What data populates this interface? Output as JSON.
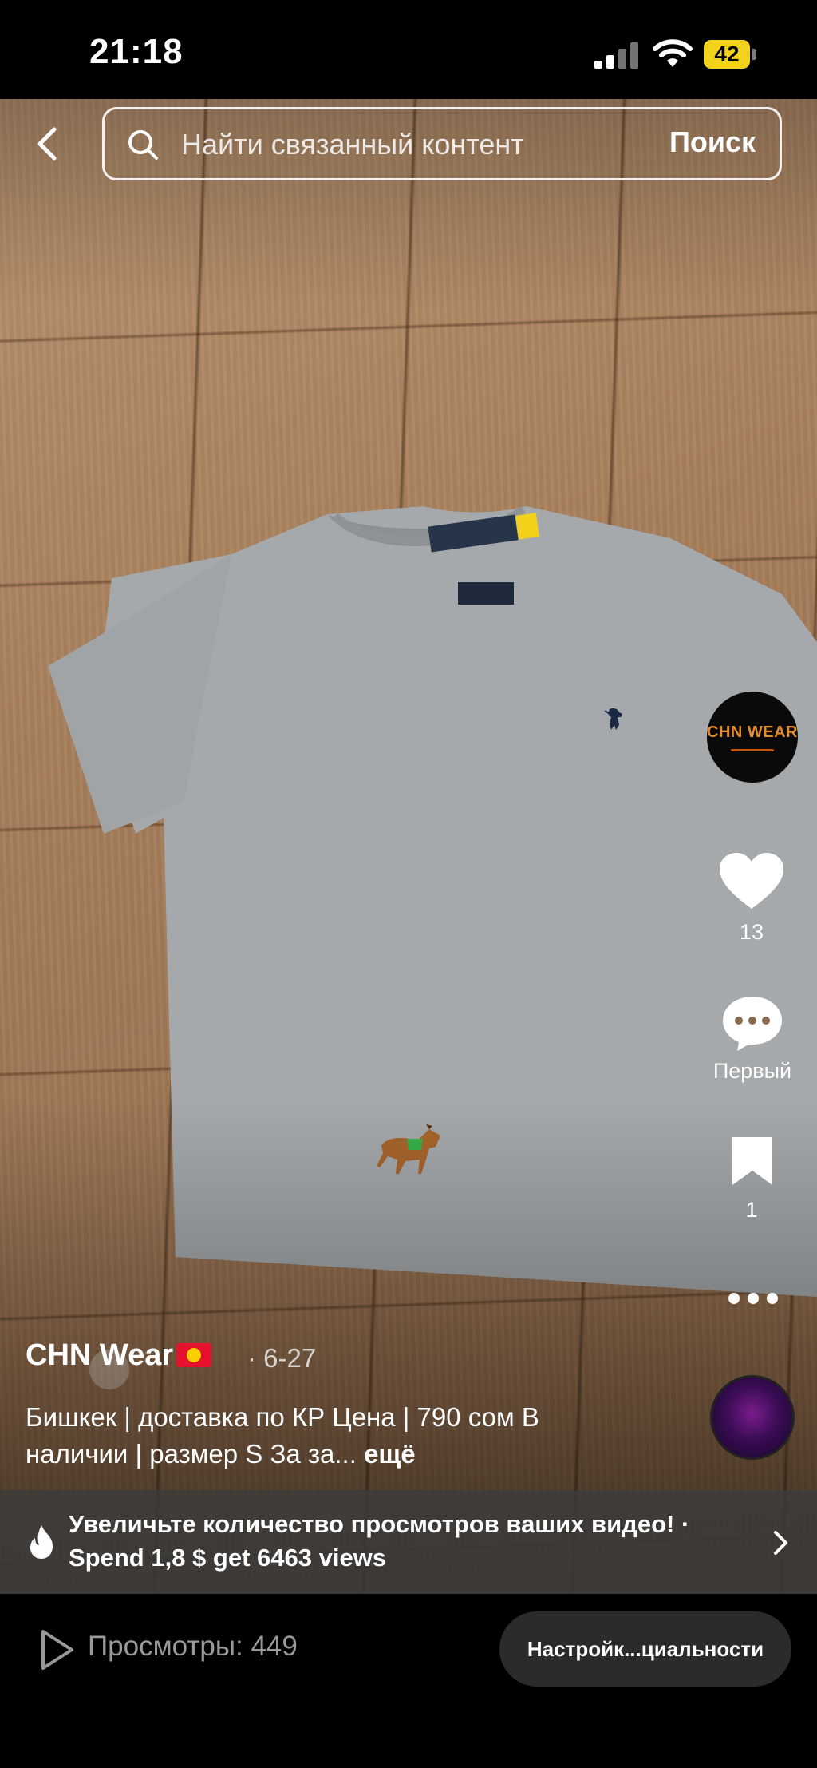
{
  "status": {
    "time": "21:18",
    "battery": "42"
  },
  "search": {
    "placeholder": "Найти связанный контент",
    "button": "Поиск"
  },
  "creator": {
    "avatar_text": "CHN WEAR",
    "name": "CHN Wear",
    "date": "6-27"
  },
  "actions": {
    "likes": "13",
    "comments_label": "Первый",
    "saves": "1"
  },
  "caption": {
    "text": "Бишкек | доставка по КР Цена | 790 сом  В наличии | размер S За за...",
    "more": "ещё"
  },
  "promo": {
    "text": "Увеличьте количество просмотров ваших видео! · Spend 1,8 $ get 6463 views"
  },
  "bottom": {
    "views": "Просмотры: 449",
    "privacy_button": "Настройк...циальности"
  },
  "icons": [
    "back-icon",
    "search-icon",
    "heart-icon",
    "comment-icon",
    "bookmark-icon",
    "more-icon",
    "fire-icon",
    "chevron-right-icon",
    "play-icon"
  ],
  "colors": {
    "battery": "#f2d21a",
    "brand_orange": "#e48b2a",
    "banner": "#3c3c3c",
    "pill": "#2b2b2b"
  }
}
